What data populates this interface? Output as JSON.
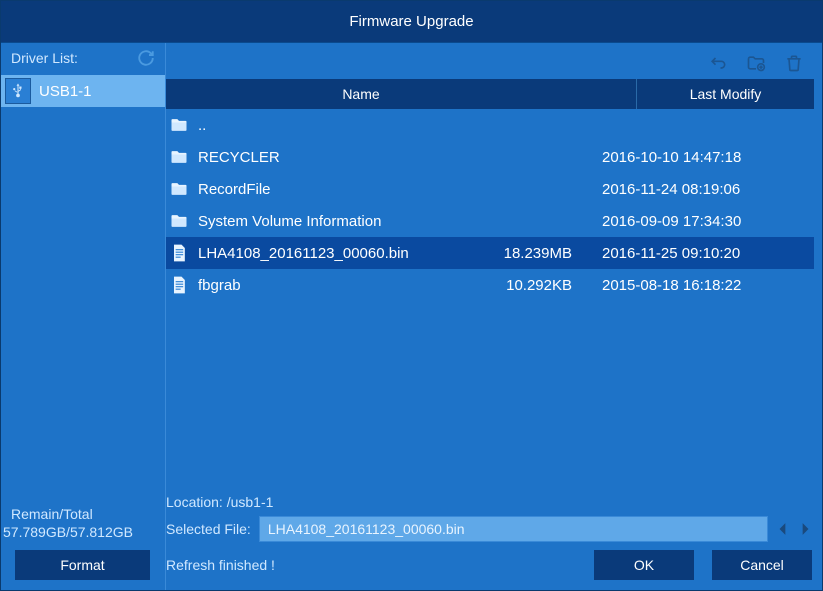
{
  "title": "Firmware Upgrade",
  "sidebar": {
    "driver_list_label": "Driver List:",
    "items": [
      {
        "label": "USB1-1"
      }
    ],
    "remain_label": "Remain/Total",
    "remain_value": "57.789GB/57.812GB",
    "format_label": "Format"
  },
  "table": {
    "header_name": "Name",
    "header_modify": "Last Modify"
  },
  "files": [
    {
      "type": "folder",
      "name": "..",
      "size": "",
      "modify": "",
      "selected": false
    },
    {
      "type": "folder",
      "name": "RECYCLER",
      "size": "",
      "modify": "2016-10-10 14:47:18",
      "selected": false
    },
    {
      "type": "folder",
      "name": "RecordFile",
      "size": "",
      "modify": "2016-11-24 08:19:06",
      "selected": false
    },
    {
      "type": "folder",
      "name": "System Volume Information",
      "size": "",
      "modify": "2016-09-09 17:34:30",
      "selected": false
    },
    {
      "type": "file",
      "name": "LHA4108_20161123_00060.bin",
      "size": "18.239MB",
      "modify": "2016-11-25 09:10:20",
      "selected": true
    },
    {
      "type": "file",
      "name": "fbgrab",
      "size": "10.292KB",
      "modify": "2015-08-18 16:18:22",
      "selected": false
    }
  ],
  "location_label": "Location:",
  "location_value": "/usb1-1",
  "selected_file_label": "Selected File:",
  "selected_file_value": "LHA4108_20161123_00060.bin",
  "status": "Refresh finished !",
  "buttons": {
    "ok": "OK",
    "cancel": "Cancel"
  }
}
